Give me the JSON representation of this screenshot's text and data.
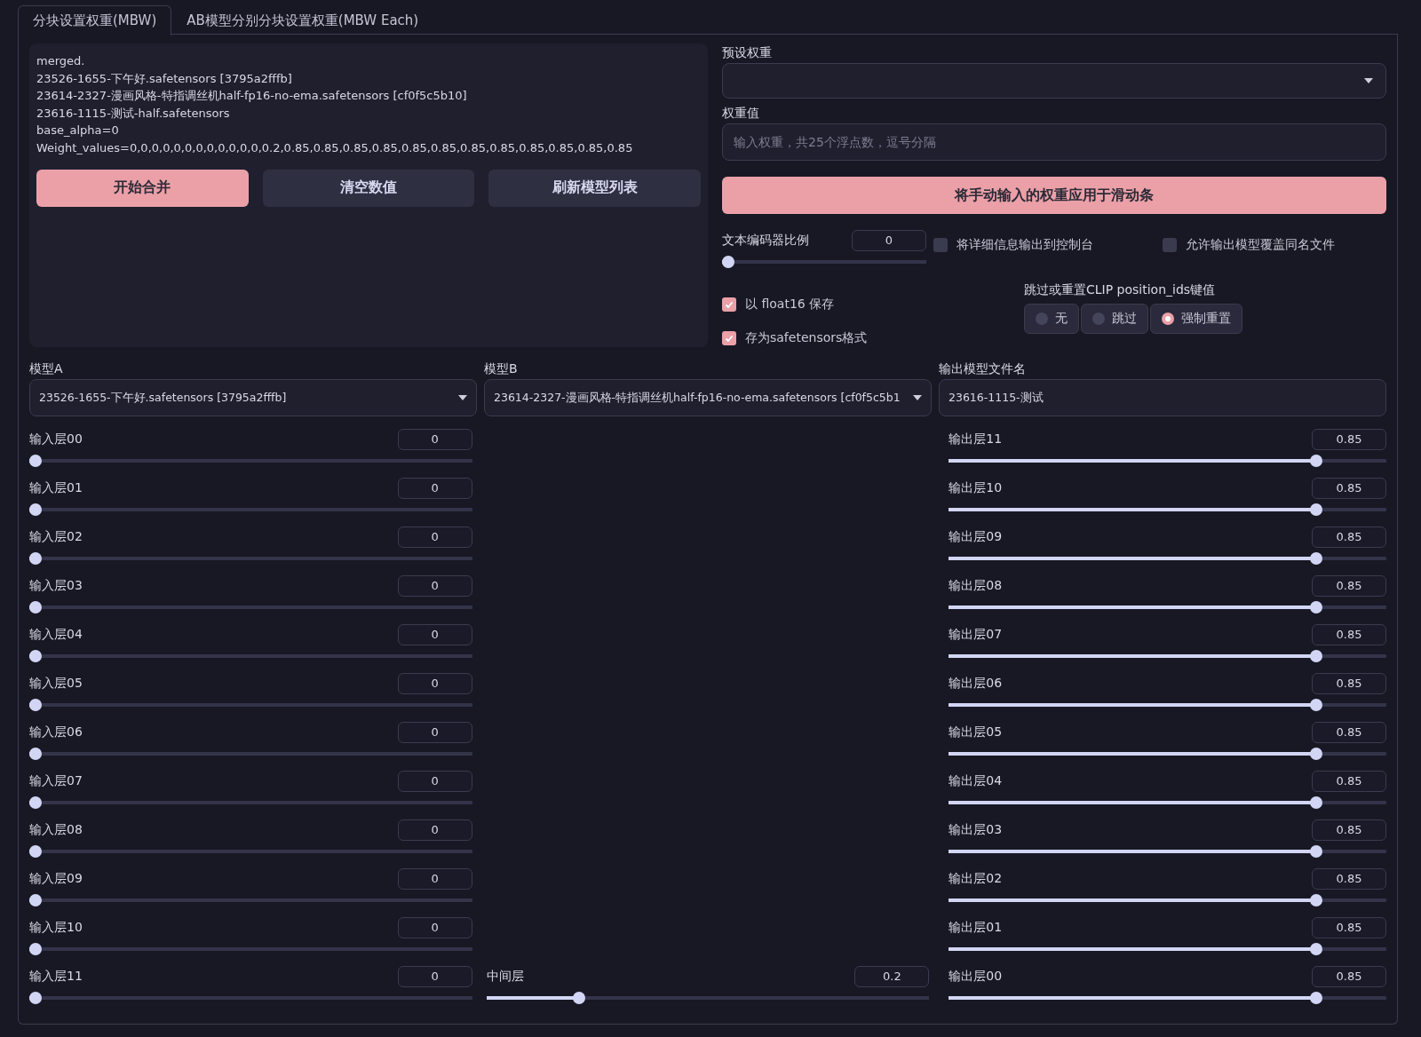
{
  "tabs": [
    {
      "label": "分块设置权重(MBW)",
      "selected": true
    },
    {
      "label": "AB模型分别分块设置权重(MBW Each)",
      "selected": false
    }
  ],
  "log": [
    "merged.",
    "23526-1655-下午好.safetensors [3795a2fffb]",
    "23614-2327-漫画风格-特指调丝机half-fp16-no-ema.safetensors [cf0f5c5b10]",
    "23616-1115-测试-half.safetensors",
    "base_alpha=0",
    "Weight_values=0,0,0,0,0,0,0,0,0,0,0,0,0.2,0.85,0.85,0.85,0.85,0.85,0.85,0.85,0.85,0.85,0.85,0.85,0.85"
  ],
  "actions": [
    {
      "label": "开始合并",
      "kind": "primary"
    },
    {
      "label": "清空数值",
      "kind": "secondary"
    },
    {
      "label": "刷新模型列表",
      "kind": "secondary"
    }
  ],
  "preset": {
    "label": "预设权重"
  },
  "weights": {
    "label": "权重值",
    "placeholder": "输入权重，共25个浮点数，逗号分隔"
  },
  "apply_button": {
    "label": "将手动输入的权重应用于滑动条"
  },
  "text_encoder": {
    "label": "文本编码器比例",
    "value": "0",
    "level": 0
  },
  "options": [
    {
      "label": "将详细信息输出到控制台",
      "checked": false
    },
    {
      "label": "允许输出模型覆盖同名文件",
      "checked": false
    },
    {
      "label": "以 float16 保存",
      "checked": true
    },
    {
      "label": "存为safetensors格式",
      "checked": true
    }
  ],
  "clip": {
    "label": "跳过或重置CLIP position_ids键值",
    "options": [
      {
        "label": "无",
        "selected": false
      },
      {
        "label": "跳过",
        "selected": false
      },
      {
        "label": "强制重置",
        "selected": true
      }
    ]
  },
  "model_a": {
    "label": "模型A",
    "value": "23526-1655-下午好.safetensors [3795a2fffb]"
  },
  "model_b": {
    "label": "模型B",
    "value": "23614-2327-漫画风格-特指调丝机half-fp16-no-ema.safetensors [cf0f5c5b1"
  },
  "output_name": {
    "label": "输出模型文件名",
    "value": "23616-1115-测试"
  },
  "input_layers": [
    {
      "label": "输入层00",
      "value": "0",
      "level": 0
    },
    {
      "label": "输入层01",
      "value": "0",
      "level": 0
    },
    {
      "label": "输入层02",
      "value": "0",
      "level": 0
    },
    {
      "label": "输入层03",
      "value": "0",
      "level": 0
    },
    {
      "label": "输入层04",
      "value": "0",
      "level": 0
    },
    {
      "label": "输入层05",
      "value": "0",
      "level": 0
    },
    {
      "label": "输入层06",
      "value": "0",
      "level": 0
    },
    {
      "label": "输入层07",
      "value": "0",
      "level": 0
    },
    {
      "label": "输入层08",
      "value": "0",
      "level": 0
    },
    {
      "label": "输入层09",
      "value": "0",
      "level": 0
    },
    {
      "label": "输入层10",
      "value": "0",
      "level": 0
    },
    {
      "label": "输入层11",
      "value": "0",
      "level": 0
    }
  ],
  "middle_layer": {
    "label": "中间层",
    "value": "0.2",
    "level": 0.2
  },
  "output_layers": [
    {
      "label": "输出层11",
      "value": "0.85",
      "level": 0.85
    },
    {
      "label": "输出层10",
      "value": "0.85",
      "level": 0.85
    },
    {
      "label": "输出层09",
      "value": "0.85",
      "level": 0.85
    },
    {
      "label": "输出层08",
      "value": "0.85",
      "level": 0.85
    },
    {
      "label": "输出层07",
      "value": "0.85",
      "level": 0.85
    },
    {
      "label": "输出层06",
      "value": "0.85",
      "level": 0.85
    },
    {
      "label": "输出层05",
      "value": "0.85",
      "level": 0.85
    },
    {
      "label": "输出层04",
      "value": "0.85",
      "level": 0.85
    },
    {
      "label": "输出层03",
      "value": "0.85",
      "level": 0.85
    },
    {
      "label": "输出层02",
      "value": "0.85",
      "level": 0.85
    },
    {
      "label": "输出层01",
      "value": "0.85",
      "level": 0.85
    },
    {
      "label": "输出层00",
      "value": "0.85",
      "level": 0.85
    }
  ]
}
